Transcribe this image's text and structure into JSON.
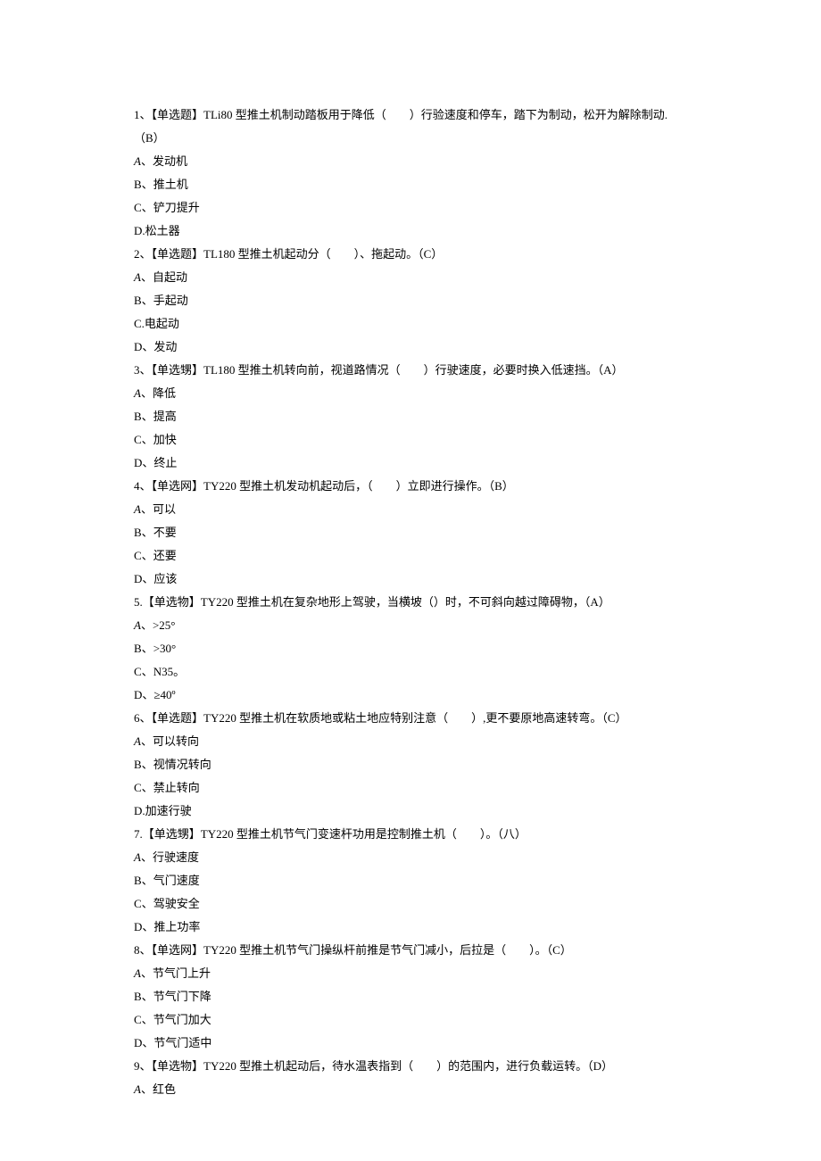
{
  "questions": [
    {
      "stem_prefix": "1、【单选题】TLi80 型推土机制动踏板用于降低（",
      "stem_suffix": "）行验速度和停车，踏下为制动，松开为解除制动.（B）",
      "options": [
        {
          "label": "A",
          "sep": "、",
          "text": "发动机",
          "italic": true
        },
        {
          "label": "B",
          "sep": "、",
          "text": "推土机"
        },
        {
          "label": "C",
          "sep": "、",
          "text": "铲刀提升"
        },
        {
          "label": "D",
          "sep": ".",
          "text": "松土器"
        }
      ]
    },
    {
      "stem_prefix": "2、【单选题】TL180 型推土机起动分（",
      "stem_suffix": "）、拖起动。（C）",
      "options": [
        {
          "label": "A",
          "sep": "、",
          "text": "自起动",
          "italic": true
        },
        {
          "label": "B",
          "sep": "、",
          "text": "手起动"
        },
        {
          "label": "C",
          "sep": ".",
          "text": "电起动"
        },
        {
          "label": "D",
          "sep": "、",
          "text": "发动"
        }
      ]
    },
    {
      "stem_prefix": "3、【单选甥】TL180 型推土机转向前，视道路情况（",
      "stem_suffix": "）行驶速度，必要时换入低速挡。（A）",
      "options": [
        {
          "label": "A",
          "sep": "、",
          "text": "降低",
          "italic": true
        },
        {
          "label": "B",
          "sep": "、",
          "text": "提高"
        },
        {
          "label": "C",
          "sep": "、",
          "text": "加快"
        },
        {
          "label": "D",
          "sep": "、",
          "text": "终止"
        }
      ]
    },
    {
      "stem_prefix": "4、【单选网】TY220 型推土机发动机起动后，（",
      "stem_suffix": "）立即进行操作。（B）",
      "options": [
        {
          "label": "A",
          "sep": "、",
          "text": "可以",
          "italic": true
        },
        {
          "label": "B",
          "sep": "、",
          "text": "不要"
        },
        {
          "label": "C",
          "sep": "、",
          "text": "还要"
        },
        {
          "label": "D",
          "sep": "、",
          "text": "应该"
        }
      ]
    },
    {
      "stem_prefix": "5.【单选物】TY220 型推土机在复杂地形上驾驶，当横坡（）时，不可斜向越过障碍物，（A）",
      "stem_suffix": "",
      "options": [
        {
          "label": "A",
          "sep": "、",
          "text": ">25°",
          "italic": true
        },
        {
          "label": "B",
          "sep": "、",
          "text": ">30°"
        },
        {
          "label": "C",
          "sep": "、",
          "text": "N35。"
        },
        {
          "label": "D",
          "sep": "、",
          "text": "≥40º"
        }
      ]
    },
    {
      "stem_prefix": "6、【单选题】TY220 型推土机在软质地或粘土地应特别注意（",
      "stem_suffix": "）,更不要原地高速转弯。（C）",
      "options": [
        {
          "label": "A",
          "sep": "、",
          "text": "可以转向",
          "italic": true
        },
        {
          "label": "B",
          "sep": "、",
          "text": "视情况转向"
        },
        {
          "label": "C",
          "sep": "、",
          "text": "禁止转向"
        },
        {
          "label": "D",
          "sep": ".",
          "text": "加速行驶"
        }
      ]
    },
    {
      "stem_prefix": "7.【单选甥】TY220 型推土机节气门变速杆功用是控制推土机（",
      "stem_suffix": "）。（八）",
      "options": [
        {
          "label": "A",
          "sep": "、",
          "text": "行驶速度",
          "italic": true
        },
        {
          "label": "B",
          "sep": "、",
          "text": "气门速度"
        },
        {
          "label": "C",
          "sep": "、",
          "text": "驾驶安全"
        },
        {
          "label": "D",
          "sep": "、",
          "text": "推上功率"
        }
      ]
    },
    {
      "stem_prefix": "8、【单选网】TY220 型推土机节气门操纵杆前推是节气门减小，后拉是（",
      "stem_suffix": "）。（C）",
      "options": [
        {
          "label": "A",
          "sep": "、",
          "text": "节气门上升",
          "italic": true
        },
        {
          "label": "B",
          "sep": "、",
          "text": "节气门下降"
        },
        {
          "label": "C",
          "sep": "、",
          "text": "节气门加大"
        },
        {
          "label": "D",
          "sep": "、",
          "text": "节气门适中"
        }
      ]
    },
    {
      "stem_prefix": "9、【单选物】TY220 型推土机起动后，待水温表指到（",
      "stem_suffix": "）的范围内，进行负载运转。（D）",
      "options": [
        {
          "label": "A",
          "sep": "、",
          "text": "红色",
          "italic": true
        }
      ]
    }
  ]
}
